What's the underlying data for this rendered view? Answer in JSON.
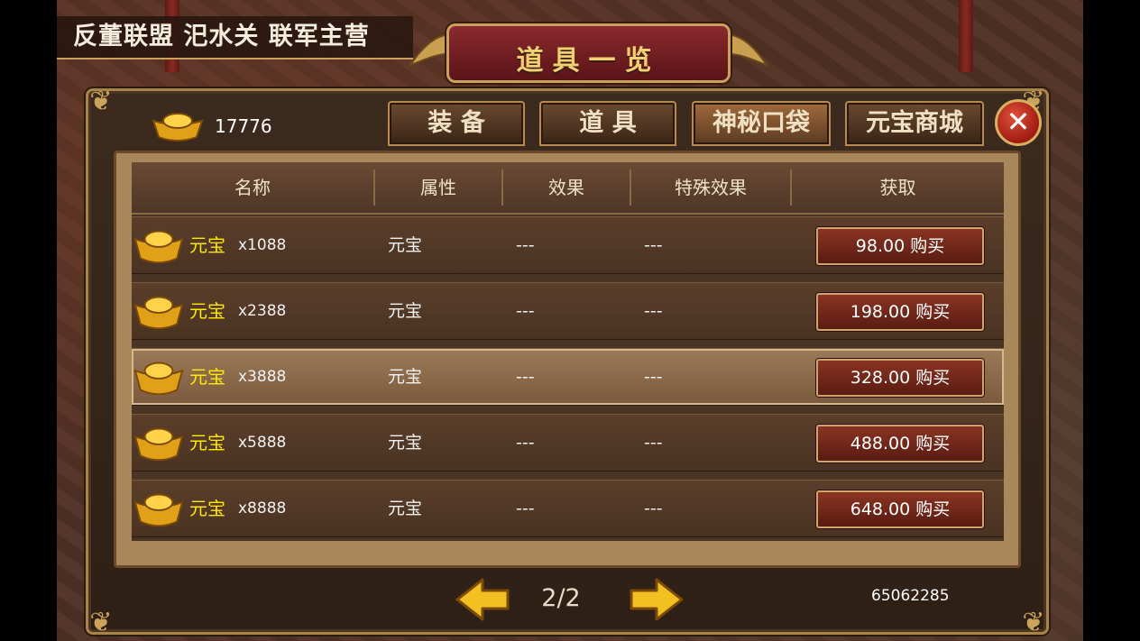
{
  "location": {
    "text": "反董联盟 汜水关   联军主营"
  },
  "window": {
    "title": "道具一览",
    "close_icon": "close-x-icon"
  },
  "currency": {
    "icon": "gold-ingot-icon",
    "amount": "17776"
  },
  "tabs": [
    {
      "label": "装 备",
      "active": false
    },
    {
      "label": "道 具",
      "active": false
    },
    {
      "label": "神秘口袋",
      "active": true
    },
    {
      "label": "元宝商城",
      "active": false
    }
  ],
  "table": {
    "headers": [
      "名称",
      "属性",
      "效果",
      "特殊效果",
      "获取"
    ],
    "rows": [
      {
        "name": "元宝",
        "qty": "x1088",
        "attr": "元宝",
        "effect": "---",
        "special": "---",
        "price": "98.00 购买",
        "highlight": false
      },
      {
        "name": "元宝",
        "qty": "x2388",
        "attr": "元宝",
        "effect": "---",
        "special": "---",
        "price": "198.00 购买",
        "highlight": false
      },
      {
        "name": "元宝",
        "qty": "x3888",
        "attr": "元宝",
        "effect": "---",
        "special": "---",
        "price": "328.00 购买",
        "highlight": true
      },
      {
        "name": "元宝",
        "qty": "x5888",
        "attr": "元宝",
        "effect": "---",
        "special": "---",
        "price": "488.00 购买",
        "highlight": false
      },
      {
        "name": "元宝",
        "qty": "x8888",
        "attr": "元宝",
        "effect": "---",
        "special": "---",
        "price": "648.00 购买",
        "highlight": false
      }
    ]
  },
  "pagination": {
    "page": "2/2",
    "prev_icon": "left-arrow-icon",
    "next_icon": "right-arrow-icon"
  },
  "player_id": "65062285",
  "colors": {
    "item_name": "#ffea00",
    "panel_border": "#a8834a",
    "title_bar": "#8a2a2e",
    "buy_button": "#8a3422"
  }
}
